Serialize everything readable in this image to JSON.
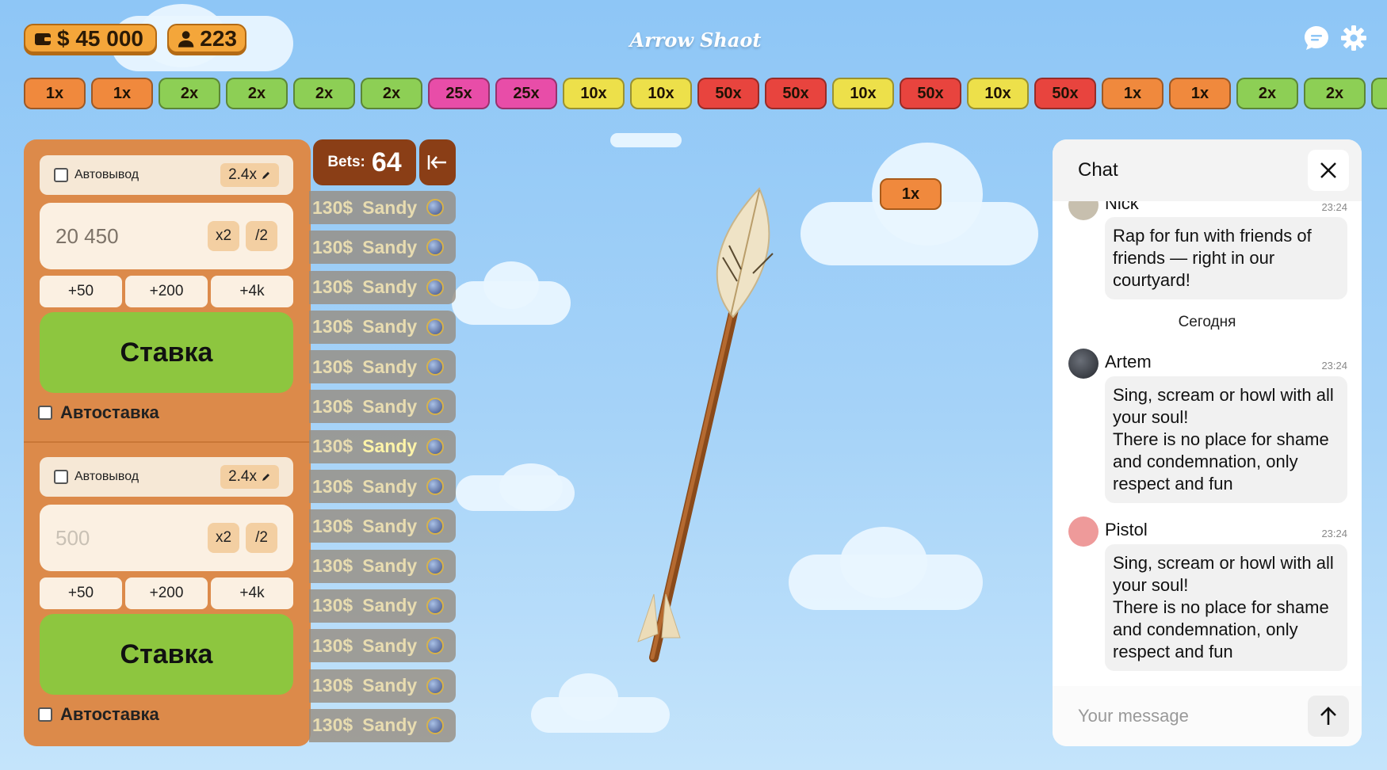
{
  "header": {
    "balance": "$ 45 000",
    "online_count": "223",
    "logo_left": "Arrow",
    "logo_right": "Shaot"
  },
  "multipliers": [
    {
      "label": "1x",
      "color": "#f0893d"
    },
    {
      "label": "1x",
      "color": "#f0893d"
    },
    {
      "label": "2x",
      "color": "#8dcf55"
    },
    {
      "label": "2x",
      "color": "#8dcf55"
    },
    {
      "label": "2x",
      "color": "#8dcf55"
    },
    {
      "label": "2x",
      "color": "#8dcf55"
    },
    {
      "label": "25x",
      "color": "#e84da8"
    },
    {
      "label": "25x",
      "color": "#e84da8"
    },
    {
      "label": "10x",
      "color": "#ede04a"
    },
    {
      "label": "10x",
      "color": "#ede04a"
    },
    {
      "label": "50x",
      "color": "#e8443e"
    },
    {
      "label": "50x",
      "color": "#e8443e"
    },
    {
      "label": "10x",
      "color": "#ede04a"
    },
    {
      "label": "50x",
      "color": "#e8443e"
    },
    {
      "label": "10x",
      "color": "#ede04a"
    },
    {
      "label": "50x",
      "color": "#e8443e"
    },
    {
      "label": "1x",
      "color": "#f0893d"
    },
    {
      "label": "1x",
      "color": "#f0893d"
    },
    {
      "label": "2x",
      "color": "#8dcf55"
    },
    {
      "label": "2x",
      "color": "#8dcf55"
    },
    {
      "label": "",
      "color": "#8dcf55"
    }
  ],
  "bet_panel_1": {
    "auto_cashout_label": "Автовывод",
    "auto_cashout_value": "2.4x",
    "amount": "20 450",
    "double_label": "x2",
    "half_label": "/2",
    "quick": [
      "+50",
      "+200",
      "+4k"
    ],
    "stake_label": "Ставка",
    "autostake_label": "Автоставка"
  },
  "bet_panel_2": {
    "auto_cashout_label": "Автовывод",
    "auto_cashout_value": "2.4x",
    "amount_placeholder": "500",
    "double_label": "x2",
    "half_label": "/2",
    "quick": [
      "+50",
      "+200",
      "+4k"
    ],
    "stake_label": "Ставка",
    "autostake_label": "Автоставка"
  },
  "bets": {
    "label": "Bets:",
    "count": "64",
    "rows": [
      {
        "amount": "130$",
        "name": "Sandy"
      },
      {
        "amount": "130$",
        "name": "Sandy"
      },
      {
        "amount": "130$",
        "name": "Sandy"
      },
      {
        "amount": "130$",
        "name": "Sandy"
      },
      {
        "amount": "130$",
        "name": "Sandy"
      },
      {
        "amount": "130$",
        "name": "Sandy"
      },
      {
        "amount": "130$",
        "name": "Sandy"
      },
      {
        "amount": "130$",
        "name": "Sandy"
      },
      {
        "amount": "130$",
        "name": "Sandy"
      },
      {
        "amount": "130$",
        "name": "Sandy"
      },
      {
        "amount": "130$",
        "name": "Sandy"
      },
      {
        "amount": "130$",
        "name": "Sandy"
      },
      {
        "amount": "130$",
        "name": "Sandy"
      },
      {
        "amount": "130$",
        "name": "Sandy"
      }
    ]
  },
  "game": {
    "current_multiplier": "1x"
  },
  "chat": {
    "title": "Chat",
    "day_separator": "Сегодня",
    "input_placeholder": "Your message",
    "messages": [
      {
        "name": "Nick",
        "time": "23:24",
        "text": "Rap for fun with friends of friends — right in our courtyard!",
        "avatar_color": "#c7bfae"
      },
      {
        "name": "Artem",
        "time": "23:24",
        "text": "Sing, scream or howl with all your soul!\nThere is no place for shame and condemnation, only respect and fun",
        "avatar_color": "#3b3f47"
      },
      {
        "name": "Pistol",
        "time": "23:24",
        "text": "Sing, scream or howl with all your soul!\nThere is no place for shame and condemnation, only respect and fun",
        "avatar_color": "#ee9a9a"
      }
    ]
  }
}
